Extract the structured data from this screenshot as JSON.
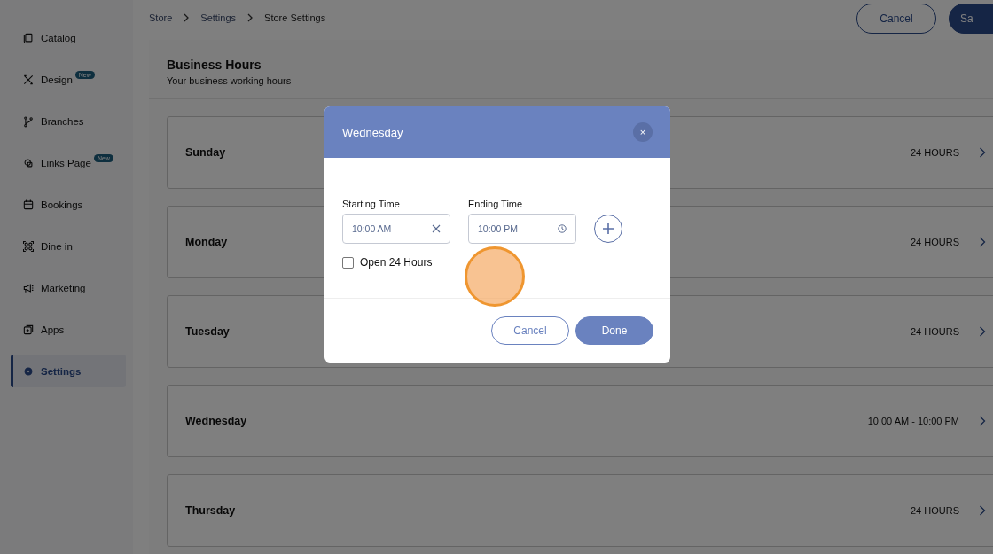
{
  "sidebar": {
    "items": [
      {
        "label": "Catalog",
        "selected": false
      },
      {
        "label": "Design",
        "badge": "New",
        "selected": false
      },
      {
        "label": "Branches",
        "selected": false
      },
      {
        "label": "Links Page",
        "badge": "New",
        "selected": false
      },
      {
        "label": "Bookings",
        "selected": false
      },
      {
        "label": "Dine in",
        "selected": false
      },
      {
        "label": "Marketing",
        "selected": false
      },
      {
        "label": "Apps",
        "selected": false
      },
      {
        "label": "Settings",
        "selected": true
      }
    ]
  },
  "breadcrumb": [
    "Store",
    "Settings",
    "Store Settings"
  ],
  "header_buttons": [
    {
      "label": "Cancel",
      "kind": "outline"
    },
    {
      "label": "Sa",
      "kind": "primary"
    }
  ],
  "section": {
    "title": "Business Hours",
    "subtitle": "Your business working hours"
  },
  "days": [
    {
      "name": "Sunday",
      "hours": "24 HOURS"
    },
    {
      "name": "Monday",
      "hours": "24 HOURS"
    },
    {
      "name": "Tuesday",
      "hours": "24 HOURS"
    },
    {
      "name": "Wednesday",
      "hours": "10:00 AM - 10:00 PM"
    },
    {
      "name": "Thursday",
      "hours": "24 HOURS"
    }
  ],
  "dialog": {
    "title": "Wednesday",
    "close": "×",
    "start": {
      "label": "Starting Time",
      "value": "10:00 AM"
    },
    "end": {
      "label": "Ending Time",
      "value": "10:00 PM"
    },
    "open24": {
      "label": "Open 24 Hours",
      "checked": false
    },
    "buttons": [
      {
        "label": "Cancel",
        "kind": "outline"
      },
      {
        "label": "Done",
        "kind": "primary"
      }
    ]
  }
}
